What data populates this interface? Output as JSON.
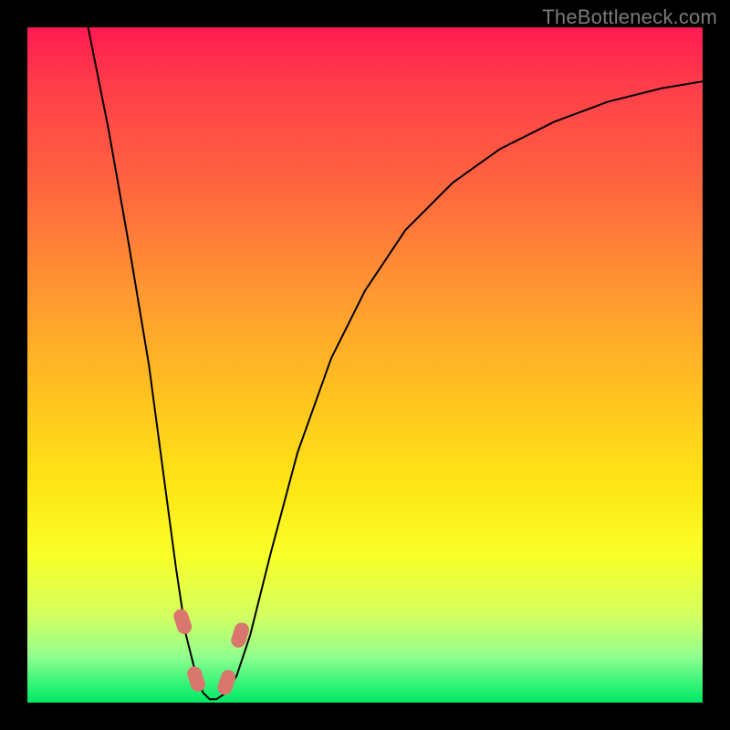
{
  "watermark": "TheBottleneck.com",
  "chart_data": {
    "type": "line",
    "title": "",
    "xlabel": "",
    "ylabel": "",
    "xlim": [
      0,
      100
    ],
    "ylim": [
      0,
      100
    ],
    "series": [
      {
        "name": "bottleneck-curve",
        "x": [
          9,
          12,
          15,
          18,
          20,
          22,
          23.5,
          25,
          26,
          27,
          28,
          29.5,
          31,
          33,
          36,
          40,
          45,
          50,
          56,
          63,
          70,
          78,
          86,
          94,
          100
        ],
        "values": [
          100,
          85,
          68,
          50,
          35,
          20,
          10,
          4,
          1.5,
          0.5,
          0.5,
          1.5,
          4,
          10,
          22,
          37,
          51,
          61,
          70,
          77,
          82,
          86,
          89,
          91,
          92
        ]
      }
    ],
    "markers": [
      {
        "name": "marker-left-upper",
        "x": 23.0,
        "y": 12
      },
      {
        "name": "marker-left-lower",
        "x": 25.0,
        "y": 3.5
      },
      {
        "name": "marker-right-lower",
        "x": 29.5,
        "y": 3.0
      },
      {
        "name": "marker-right-upper",
        "x": 31.5,
        "y": 10
      }
    ],
    "colors": {
      "curve": "#000000",
      "marker": "#d9766e"
    }
  }
}
